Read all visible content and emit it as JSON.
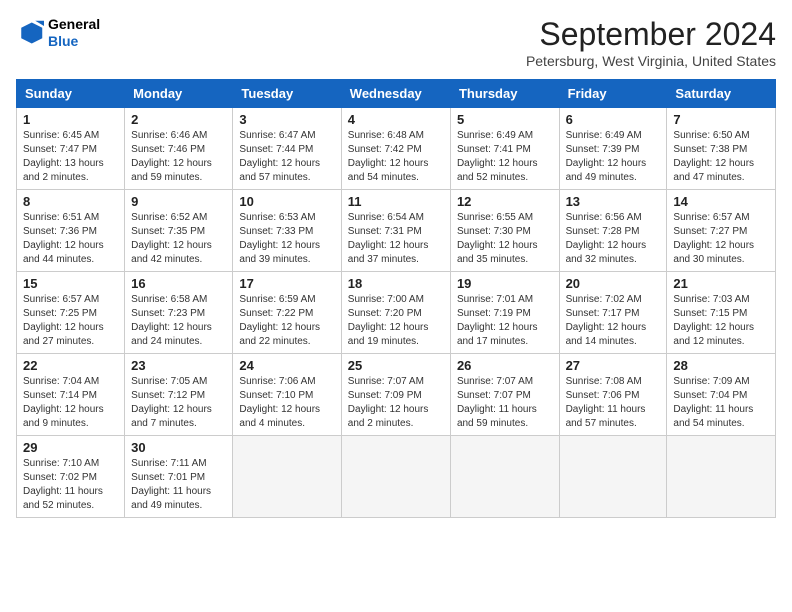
{
  "logo": {
    "line1": "General",
    "line2": "Blue"
  },
  "title": "September 2024",
  "location": "Petersburg, West Virginia, United States",
  "weekdays": [
    "Sunday",
    "Monday",
    "Tuesday",
    "Wednesday",
    "Thursday",
    "Friday",
    "Saturday"
  ],
  "weeks": [
    [
      {
        "day": "1",
        "info": "Sunrise: 6:45 AM\nSunset: 7:47 PM\nDaylight: 13 hours\nand 2 minutes."
      },
      {
        "day": "2",
        "info": "Sunrise: 6:46 AM\nSunset: 7:46 PM\nDaylight: 12 hours\nand 59 minutes."
      },
      {
        "day": "3",
        "info": "Sunrise: 6:47 AM\nSunset: 7:44 PM\nDaylight: 12 hours\nand 57 minutes."
      },
      {
        "day": "4",
        "info": "Sunrise: 6:48 AM\nSunset: 7:42 PM\nDaylight: 12 hours\nand 54 minutes."
      },
      {
        "day": "5",
        "info": "Sunrise: 6:49 AM\nSunset: 7:41 PM\nDaylight: 12 hours\nand 52 minutes."
      },
      {
        "day": "6",
        "info": "Sunrise: 6:49 AM\nSunset: 7:39 PM\nDaylight: 12 hours\nand 49 minutes."
      },
      {
        "day": "7",
        "info": "Sunrise: 6:50 AM\nSunset: 7:38 PM\nDaylight: 12 hours\nand 47 minutes."
      }
    ],
    [
      {
        "day": "8",
        "info": "Sunrise: 6:51 AM\nSunset: 7:36 PM\nDaylight: 12 hours\nand 44 minutes."
      },
      {
        "day": "9",
        "info": "Sunrise: 6:52 AM\nSunset: 7:35 PM\nDaylight: 12 hours\nand 42 minutes."
      },
      {
        "day": "10",
        "info": "Sunrise: 6:53 AM\nSunset: 7:33 PM\nDaylight: 12 hours\nand 39 minutes."
      },
      {
        "day": "11",
        "info": "Sunrise: 6:54 AM\nSunset: 7:31 PM\nDaylight: 12 hours\nand 37 minutes."
      },
      {
        "day": "12",
        "info": "Sunrise: 6:55 AM\nSunset: 7:30 PM\nDaylight: 12 hours\nand 35 minutes."
      },
      {
        "day": "13",
        "info": "Sunrise: 6:56 AM\nSunset: 7:28 PM\nDaylight: 12 hours\nand 32 minutes."
      },
      {
        "day": "14",
        "info": "Sunrise: 6:57 AM\nSunset: 7:27 PM\nDaylight: 12 hours\nand 30 minutes."
      }
    ],
    [
      {
        "day": "15",
        "info": "Sunrise: 6:57 AM\nSunset: 7:25 PM\nDaylight: 12 hours\nand 27 minutes."
      },
      {
        "day": "16",
        "info": "Sunrise: 6:58 AM\nSunset: 7:23 PM\nDaylight: 12 hours\nand 24 minutes."
      },
      {
        "day": "17",
        "info": "Sunrise: 6:59 AM\nSunset: 7:22 PM\nDaylight: 12 hours\nand 22 minutes."
      },
      {
        "day": "18",
        "info": "Sunrise: 7:00 AM\nSunset: 7:20 PM\nDaylight: 12 hours\nand 19 minutes."
      },
      {
        "day": "19",
        "info": "Sunrise: 7:01 AM\nSunset: 7:19 PM\nDaylight: 12 hours\nand 17 minutes."
      },
      {
        "day": "20",
        "info": "Sunrise: 7:02 AM\nSunset: 7:17 PM\nDaylight: 12 hours\nand 14 minutes."
      },
      {
        "day": "21",
        "info": "Sunrise: 7:03 AM\nSunset: 7:15 PM\nDaylight: 12 hours\nand 12 minutes."
      }
    ],
    [
      {
        "day": "22",
        "info": "Sunrise: 7:04 AM\nSunset: 7:14 PM\nDaylight: 12 hours\nand 9 minutes."
      },
      {
        "day": "23",
        "info": "Sunrise: 7:05 AM\nSunset: 7:12 PM\nDaylight: 12 hours\nand 7 minutes."
      },
      {
        "day": "24",
        "info": "Sunrise: 7:06 AM\nSunset: 7:10 PM\nDaylight: 12 hours\nand 4 minutes."
      },
      {
        "day": "25",
        "info": "Sunrise: 7:07 AM\nSunset: 7:09 PM\nDaylight: 12 hours\nand 2 minutes."
      },
      {
        "day": "26",
        "info": "Sunrise: 7:07 AM\nSunset: 7:07 PM\nDaylight: 11 hours\nand 59 minutes."
      },
      {
        "day": "27",
        "info": "Sunrise: 7:08 AM\nSunset: 7:06 PM\nDaylight: 11 hours\nand 57 minutes."
      },
      {
        "day": "28",
        "info": "Sunrise: 7:09 AM\nSunset: 7:04 PM\nDaylight: 11 hours\nand 54 minutes."
      }
    ],
    [
      {
        "day": "29",
        "info": "Sunrise: 7:10 AM\nSunset: 7:02 PM\nDaylight: 11 hours\nand 52 minutes."
      },
      {
        "day": "30",
        "info": "Sunrise: 7:11 AM\nSunset: 7:01 PM\nDaylight: 11 hours\nand 49 minutes."
      },
      {
        "day": "",
        "info": ""
      },
      {
        "day": "",
        "info": ""
      },
      {
        "day": "",
        "info": ""
      },
      {
        "day": "",
        "info": ""
      },
      {
        "day": "",
        "info": ""
      }
    ]
  ]
}
